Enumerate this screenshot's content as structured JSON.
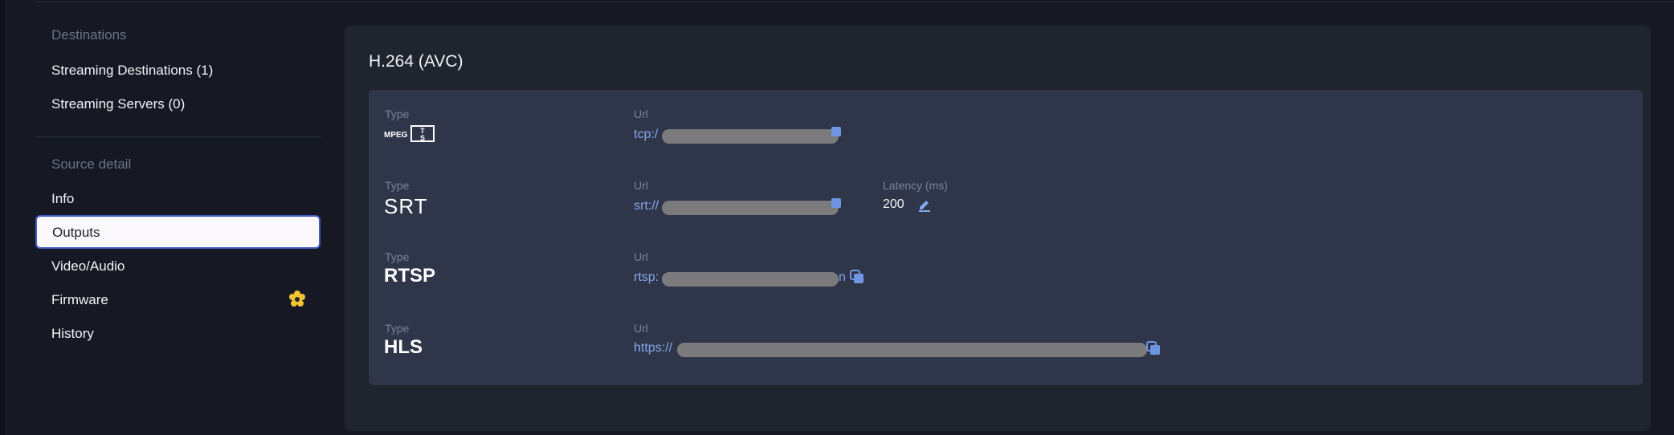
{
  "sidebar": {
    "destinations_label": "Destinations",
    "streaming_destinations": "Streaming Destinations (1)",
    "streaming_servers": "Streaming Servers (0)",
    "source_detail_label": "Source detail",
    "items": [
      {
        "label": "Info"
      },
      {
        "label": "Outputs"
      },
      {
        "label": "Video/Audio"
      },
      {
        "label": "Firmware"
      },
      {
        "label": "History"
      }
    ],
    "firmware_badge_icon": "gear-badge-icon"
  },
  "panel": {
    "title": "H.264 (AVC)",
    "outputs": [
      {
        "type_label": "Type",
        "type_logo_text": "MPEG TS",
        "url_label": "Url",
        "url_prefix": "tcp:/"
      },
      {
        "type_label": "Type",
        "type_logo_text": "SRT",
        "url_label": "Url",
        "url_prefix": "srt://",
        "latency_label": "Latency (ms)",
        "latency_value": "200"
      },
      {
        "type_label": "Type",
        "type_text": "RTSP",
        "url_label": "Url",
        "url_prefix": "rtsp:",
        "url_suffix": "n"
      },
      {
        "type_label": "Type",
        "type_text": "HLS",
        "url_label": "Url",
        "url_prefix": "https://"
      }
    ]
  },
  "colors": {
    "accent": "#86a8ec",
    "badge": "#f2c230",
    "selected_border": "#3f5cc2"
  }
}
